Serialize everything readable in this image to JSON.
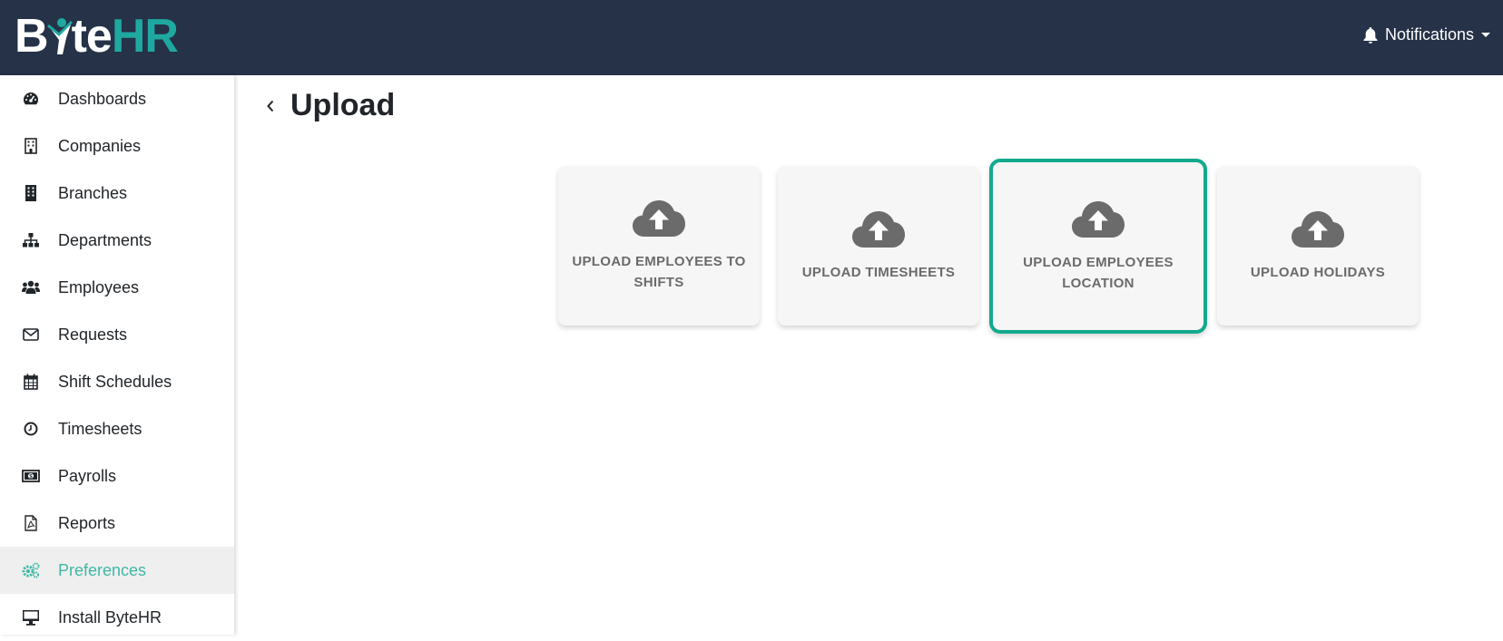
{
  "app": {
    "logo_text_1": "B",
    "logo_text_2": "te",
    "logo_text_3": "HR",
    "notifications_label": "Notifications"
  },
  "sidebar": {
    "items": [
      {
        "label": "Dashboards",
        "icon": "tachometer-icon"
      },
      {
        "label": "Companies",
        "icon": "building-icon"
      },
      {
        "label": "Branches",
        "icon": "building-solid-icon"
      },
      {
        "label": "Departments",
        "icon": "sitemap-icon"
      },
      {
        "label": "Employees",
        "icon": "users-icon"
      },
      {
        "label": "Requests",
        "icon": "envelope-icon"
      },
      {
        "label": "Shift Schedules",
        "icon": "calendar-icon"
      },
      {
        "label": "Timesheets",
        "icon": "clock-icon"
      },
      {
        "label": "Payrolls",
        "icon": "money-bill-icon"
      },
      {
        "label": "Reports",
        "icon": "file-pdf-icon"
      },
      {
        "label": "Preferences",
        "icon": "cogs-icon",
        "active": true
      },
      {
        "label": "Install ByteHR",
        "icon": "desktop-icon"
      }
    ]
  },
  "main": {
    "title": "Upload",
    "cards": [
      {
        "label": "UPLOAD EMPLOYEES TO SHIFTS"
      },
      {
        "label": "UPLOAD TIMESHEETS"
      },
      {
        "label": "UPLOAD EMPLOYEES LOCATION",
        "selected": true
      },
      {
        "label": "UPLOAD HOLIDAYS"
      }
    ]
  },
  "colors": {
    "topbar": "#253247",
    "accent": "#3eb8a6",
    "selected_border": "#13a98e",
    "card_bg": "#f6f6f6",
    "card_text": "#6b6b6b"
  }
}
